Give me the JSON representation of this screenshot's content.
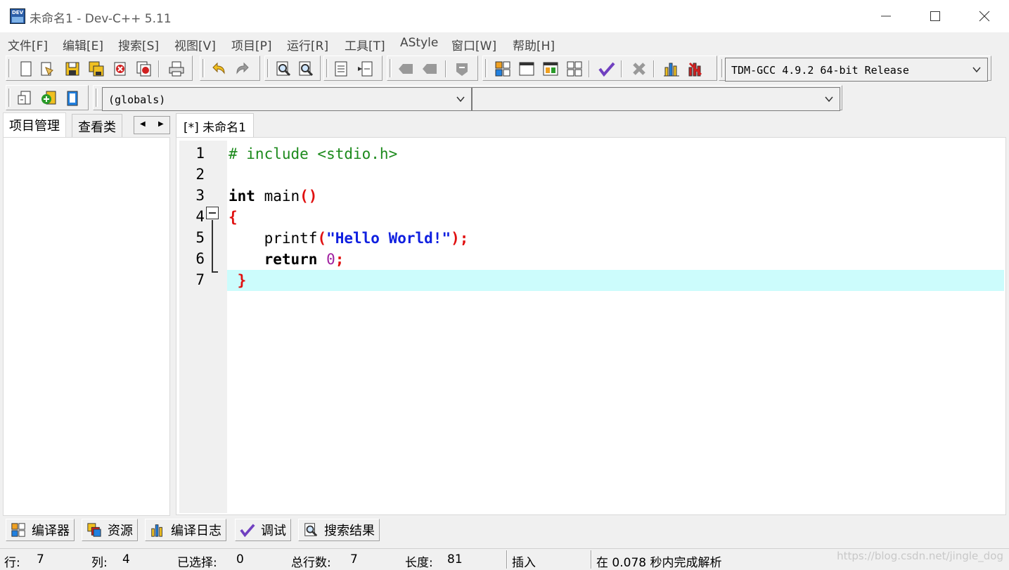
{
  "window": {
    "title": "未命名1 - Dev-C++ 5.11",
    "app_icon_text": "DEV"
  },
  "menubar": [
    "文件[F]",
    "编辑[E]",
    "搜索[S]",
    "视图[V]",
    "项目[P]",
    "运行[R]",
    "工具[T]",
    "AStyle",
    "窗口[W]",
    "帮助[H]"
  ],
  "toolbar": {
    "compiler_select": "TDM-GCC 4.9.2 64-bit Release",
    "scope_select": "(globals)",
    "symbol_select": ""
  },
  "left_panel": {
    "tabs": [
      "项目管理",
      "查看类"
    ]
  },
  "editor": {
    "tab_label": "[*] 未命名1",
    "line_numbers": [
      "1",
      "2",
      "3",
      "4",
      "5",
      "6",
      "7"
    ],
    "lines": [
      [
        {
          "t": "# include <stdio.h>",
          "c": "pre"
        }
      ],
      [],
      [
        {
          "t": "int",
          "c": "kw"
        },
        {
          "t": " main",
          "c": "plain"
        },
        {
          "t": "()",
          "c": "sym"
        }
      ],
      [
        {
          "t": "{",
          "c": "sym"
        }
      ],
      [
        {
          "t": "    printf",
          "c": "plain"
        },
        {
          "t": "(",
          "c": "sym"
        },
        {
          "t": "\"Hello World!\"",
          "c": "str"
        },
        {
          "t": ");",
          "c": "sym"
        }
      ],
      [
        {
          "t": "    ",
          "c": "plain"
        },
        {
          "t": "return",
          "c": "kw"
        },
        {
          "t": " ",
          "c": "plain"
        },
        {
          "t": "0",
          "c": "num"
        },
        {
          "t": ";",
          "c": "sym"
        }
      ],
      [
        {
          "t": " }",
          "c": "sym"
        }
      ]
    ],
    "highlighted_line": 7
  },
  "bottom_tabs": [
    "编译器",
    "资源",
    "编译日志",
    "调试",
    "搜索结果"
  ],
  "status": {
    "row_label": "行:",
    "row": "7",
    "col_label": "列:",
    "col": "4",
    "sel_label": "已选择:",
    "sel": "0",
    "total_label": "总行数:",
    "total": "7",
    "len_label": "长度:",
    "len": "81",
    "mode": "插入",
    "message": "在 0.078 秒内完成解析"
  },
  "watermark": "https://blog.csdn.net/jingle_dog",
  "colors": {
    "preprocessor": "#1c8a1c",
    "symbol": "#e01010",
    "string": "#1020e0",
    "number": "#a020a0",
    "current_line": "#ccfcfc"
  }
}
